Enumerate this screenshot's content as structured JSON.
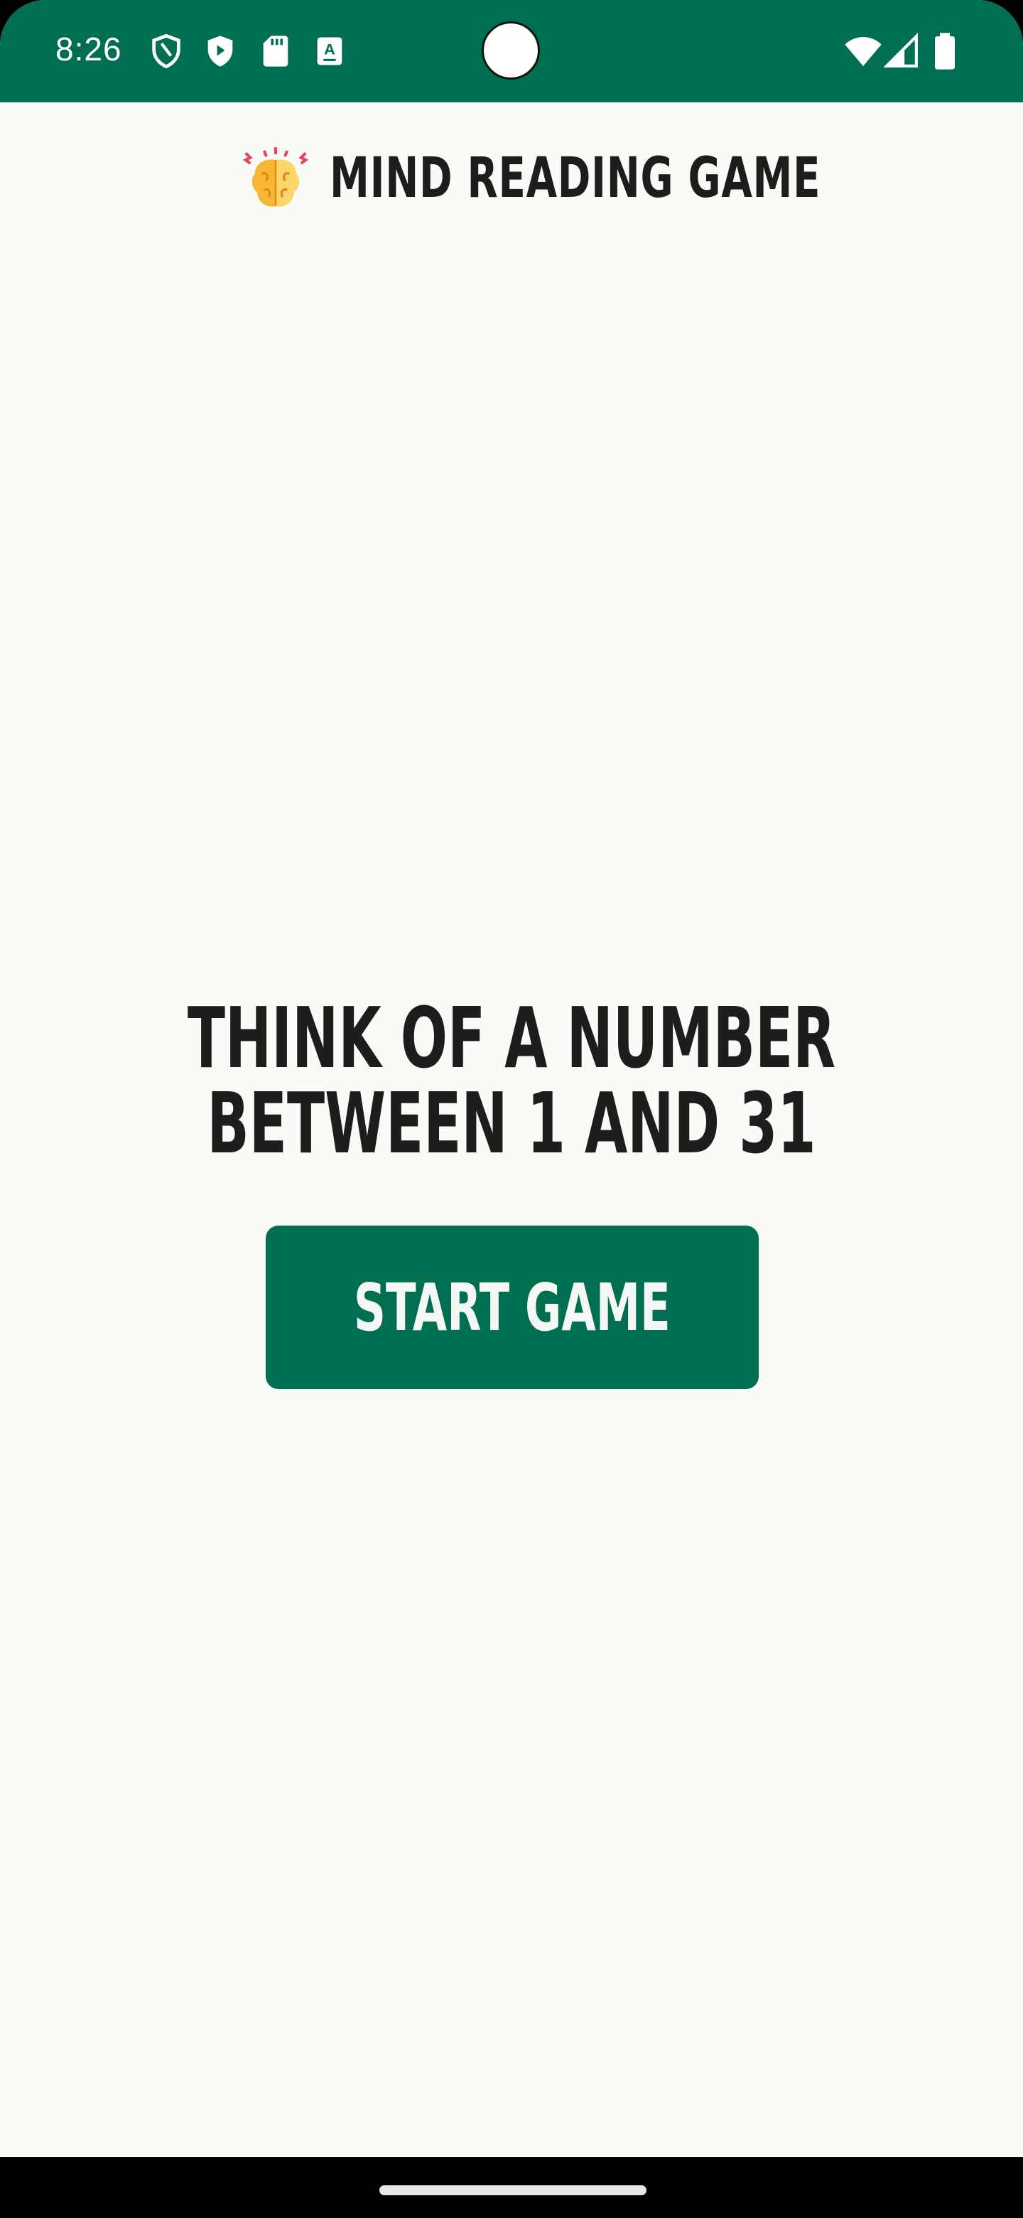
{
  "status_bar": {
    "time": "8:26",
    "color": "#006e51",
    "icons_left": [
      "shield-outline-icon",
      "shield-play-icon",
      "sd-card-icon",
      "keyboard-a-icon"
    ],
    "icons_right": [
      "wifi-icon",
      "cellular-signal-icon",
      "battery-icon"
    ]
  },
  "header": {
    "title": "MIND READING GAME",
    "icon": "brain-icon"
  },
  "main": {
    "prompt_line1": "THINK OF A NUMBER",
    "prompt_line2": "BETWEEN 1 AND 31",
    "start_button_label": "START GAME",
    "accent_color": "#006e51",
    "background_color": "#f9fbf7"
  }
}
